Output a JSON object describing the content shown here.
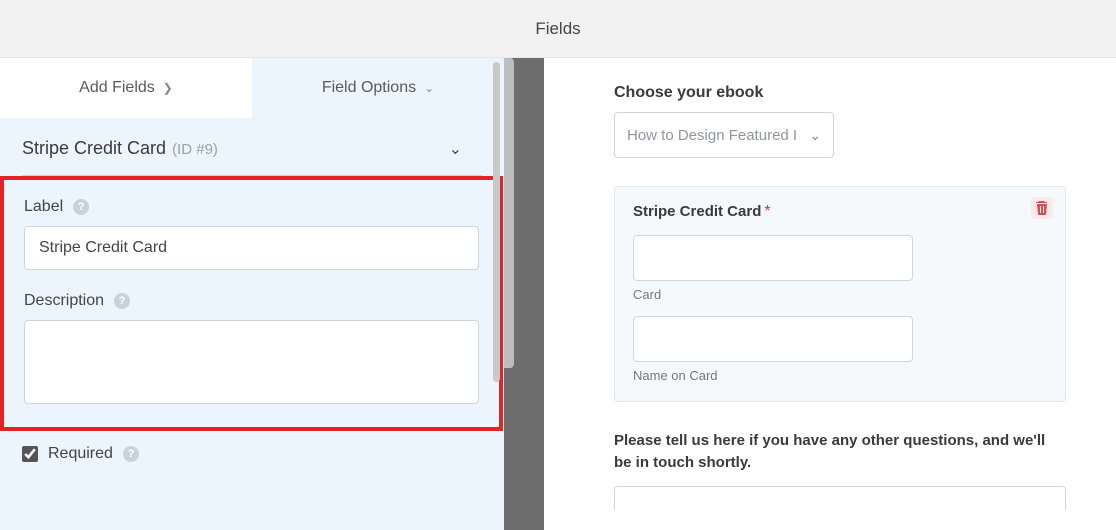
{
  "topbar": {
    "title": "Fields"
  },
  "tabs": {
    "add_fields": "Add Fields",
    "field_options": "Field Options"
  },
  "field": {
    "title": "Stripe Credit Card",
    "id": "(ID #9)",
    "label_caption": "Label",
    "label_value": "Stripe Credit Card",
    "description_caption": "Description",
    "description_value": "",
    "required_caption": "Required",
    "required_checked": true
  },
  "preview": {
    "ebook_label": "Choose your ebook",
    "ebook_selected": "How to Design Featured I",
    "card_block_title": "Stripe Credit Card",
    "card_sublabel": "Card",
    "name_sublabel": "Name on Card",
    "questions_label": "Please tell us here if you have any other questions, and we'll be in touch shortly."
  }
}
